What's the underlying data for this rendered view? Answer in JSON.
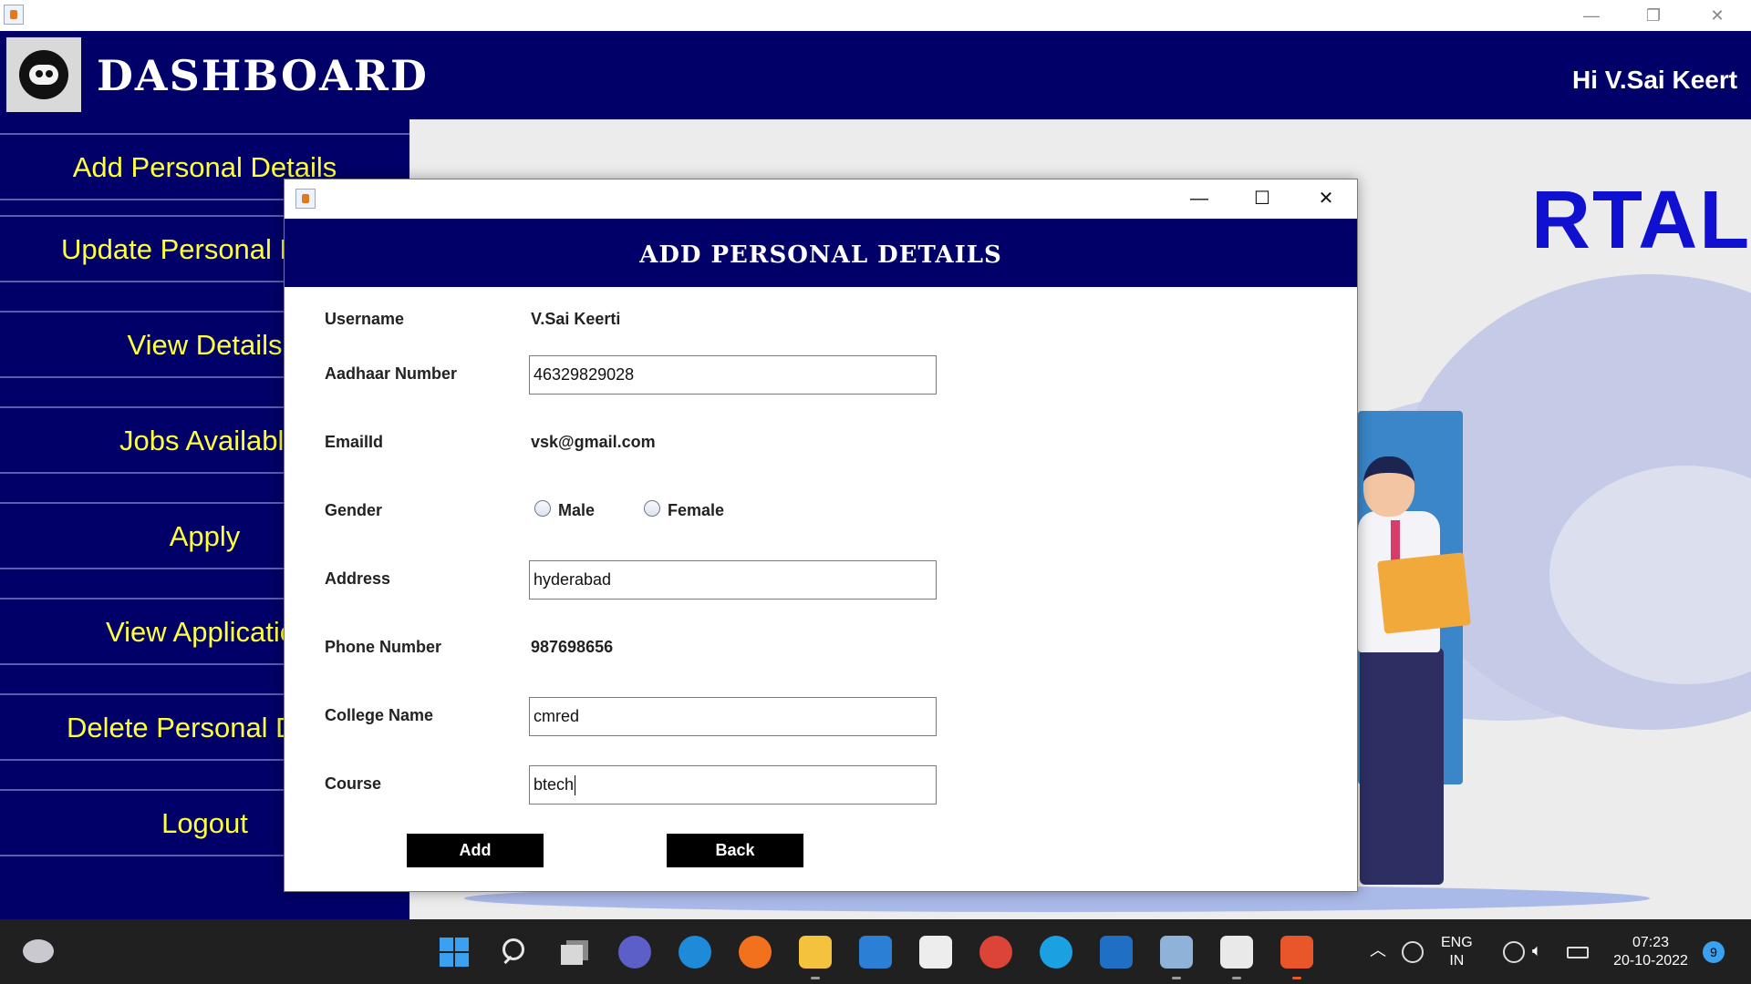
{
  "outer_window": {
    "minimize": "—",
    "restore": "❐",
    "close": "✕"
  },
  "dashboard": {
    "title": "DASHBOARD",
    "greeting": "Hi V.Sai Keert"
  },
  "sidebar": {
    "items": [
      {
        "label": "Add Personal Details"
      },
      {
        "label": "Update Personal Details"
      },
      {
        "label": "View Details"
      },
      {
        "label": "Jobs Available"
      },
      {
        "label": "Apply"
      },
      {
        "label": "View Applications"
      },
      {
        "label": "Delete Personal Details"
      },
      {
        "label": "Logout"
      }
    ]
  },
  "background": {
    "portal_text": "RTAL"
  },
  "dialog": {
    "controls": {
      "minimize": "—",
      "maximize": "☐",
      "close": "✕"
    },
    "heading": "ADD PERSONAL DETAILS",
    "fields": {
      "username": {
        "label": "Username",
        "value": "V.Sai Keerti"
      },
      "aadhaar": {
        "label": "Aadhaar Number",
        "value": "46329829028"
      },
      "email": {
        "label": "EmailId",
        "value": "vsk@gmail.com"
      },
      "gender": {
        "label": "Gender",
        "options": [
          "Male",
          "Female"
        ],
        "selected": null
      },
      "address": {
        "label": "Address",
        "value": "hyderabad"
      },
      "phone": {
        "label": "Phone Number",
        "value": "987698656"
      },
      "college": {
        "label": "College Name",
        "value": "cmred"
      },
      "course": {
        "label": "Course",
        "value": "btech"
      }
    },
    "buttons": {
      "add": "Add",
      "back": "Back"
    }
  },
  "taskbar": {
    "tray": {
      "language": "ENG",
      "region": "IN",
      "time": "07:23",
      "date": "20-10-2022",
      "notification_count": "9"
    }
  }
}
